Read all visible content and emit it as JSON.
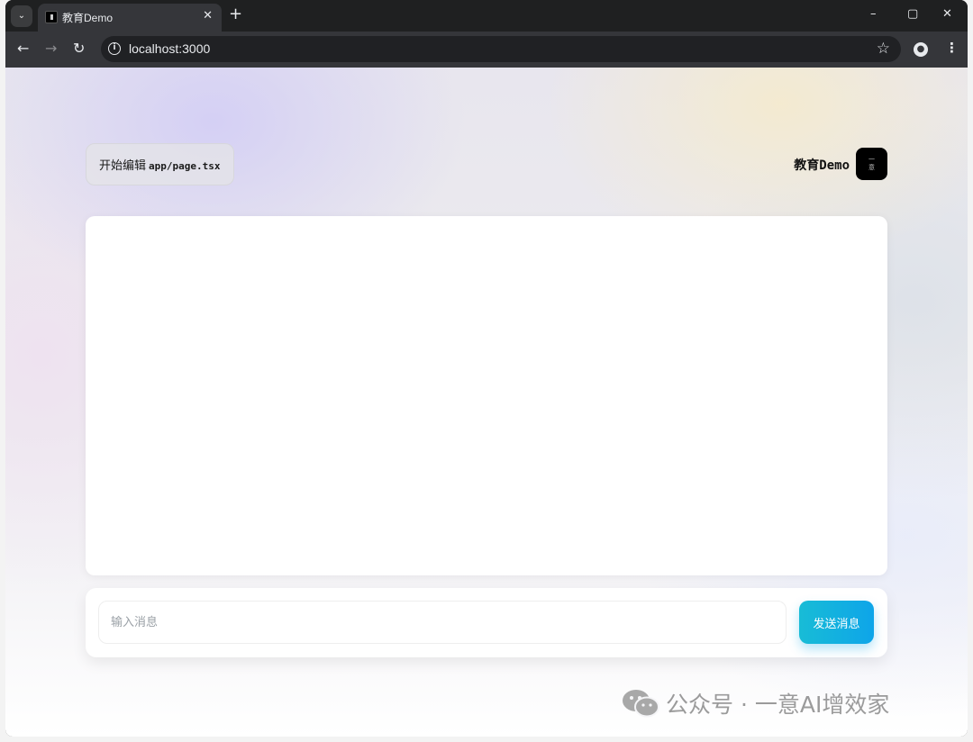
{
  "browser": {
    "tab_title": "教育Demo",
    "tab_close": "✕",
    "new_tab": "+",
    "url": "localhost:3000",
    "controls": {
      "minimize": "–",
      "maximize": "▢",
      "close": "✕"
    }
  },
  "page": {
    "edit_hint_prefix": "开始编辑",
    "edit_hint_file": "app/page.tsx",
    "brand_name": "教育Demo",
    "brand_logo_text": "一\n意",
    "input_placeholder": "输入消息",
    "send_label": "发送消息"
  },
  "watermark": {
    "text": "公众号 · 一意AI增效家"
  },
  "colors": {
    "send_button": "#0ea5e9",
    "browser_frame": "#1f2021",
    "toolbar": "#35363a"
  },
  "icons": [
    "tab-search-icon",
    "favicon-icon",
    "back-icon",
    "forward-icon",
    "reload-icon",
    "info-icon",
    "star-icon",
    "profile-icon",
    "menu-icon",
    "wechat-icon"
  ]
}
